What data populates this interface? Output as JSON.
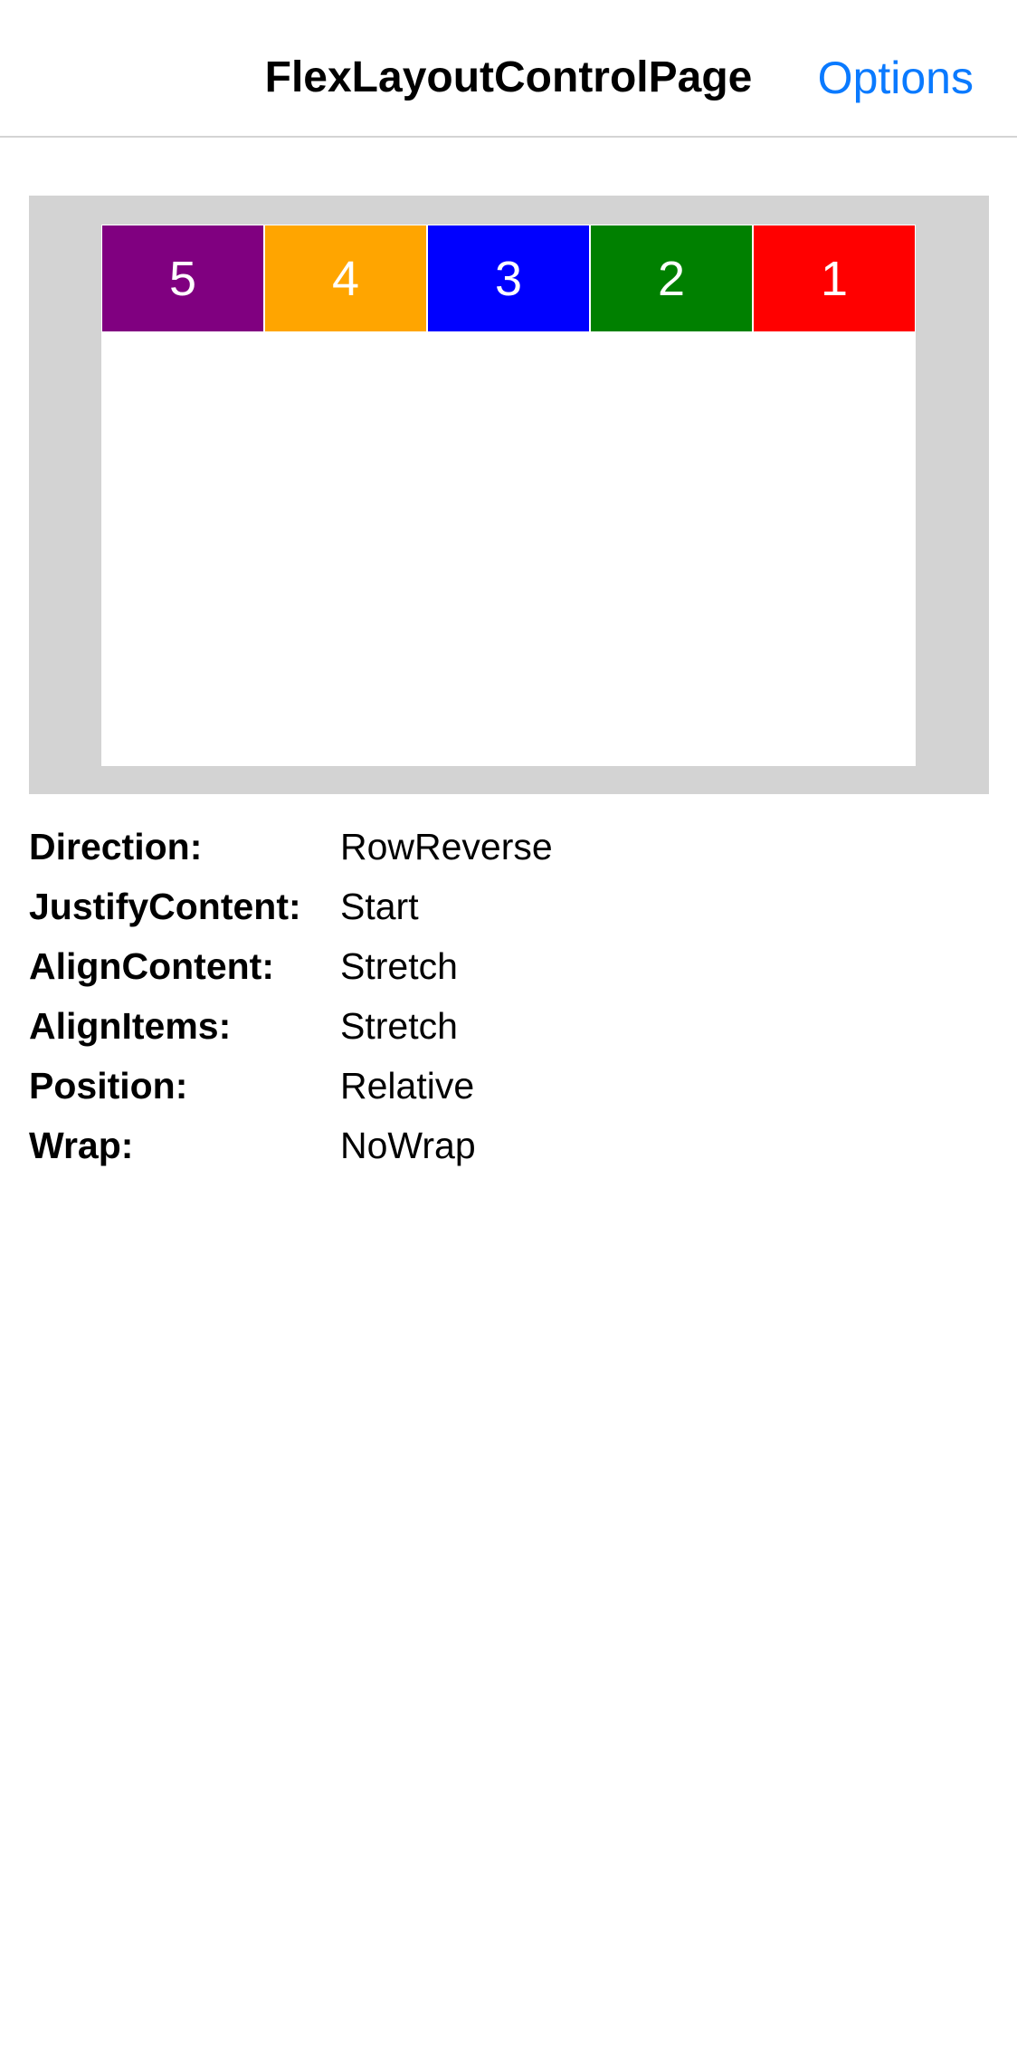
{
  "nav": {
    "title": "FlexLayoutControlPage",
    "options_label": "Options",
    "options_color": "#0a7aff"
  },
  "flex_demo": {
    "outer_color": "#d3d3d3",
    "inner_color": "#ffffff",
    "items": [
      {
        "label": "5",
        "color": "#800080"
      },
      {
        "label": "4",
        "color": "#ffa500"
      },
      {
        "label": "3",
        "color": "#0000ff"
      },
      {
        "label": "2",
        "color": "#008000"
      },
      {
        "label": "1",
        "color": "#ff0000"
      }
    ]
  },
  "properties": [
    {
      "label": "Direction:",
      "value": "RowReverse"
    },
    {
      "label": "JustifyContent:",
      "value": "Start"
    },
    {
      "label": "AlignContent:",
      "value": "Stretch"
    },
    {
      "label": "AlignItems:",
      "value": "Stretch"
    },
    {
      "label": "Position:",
      "value": "Relative"
    },
    {
      "label": "Wrap:",
      "value": "NoWrap"
    }
  ]
}
